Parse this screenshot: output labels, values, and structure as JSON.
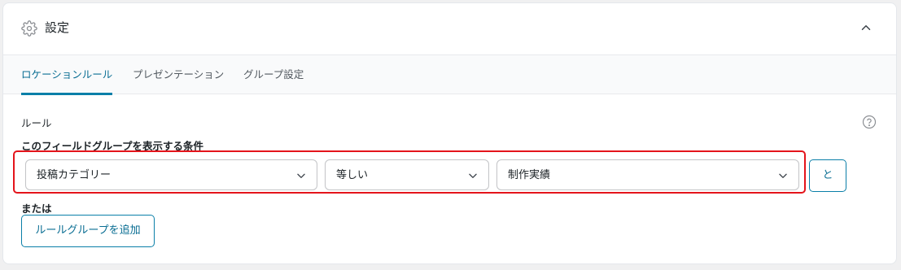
{
  "panel": {
    "title": "設定"
  },
  "tabs": [
    {
      "label": "ロケーションルール",
      "active": true
    },
    {
      "label": "プレゼンテーション",
      "active": false
    },
    {
      "label": "グループ設定",
      "active": false
    }
  ],
  "rules": {
    "section_label": "ルール",
    "condition_label": "このフィールドグループを表示する条件",
    "rule_row": {
      "param": "投稿カテゴリー",
      "operator": "等しい",
      "value": "制作実績",
      "and_label": "と"
    },
    "or_label": "または",
    "add_group_label": "ルールグループを追加"
  },
  "colors": {
    "accent": "#0a7fa8",
    "highlight": "#e4141b"
  },
  "icons": {
    "settings": "gear-icon",
    "collapse": "chevron-up-icon",
    "help": "question-circle-icon",
    "dropdown": "chevron-down-icon"
  }
}
